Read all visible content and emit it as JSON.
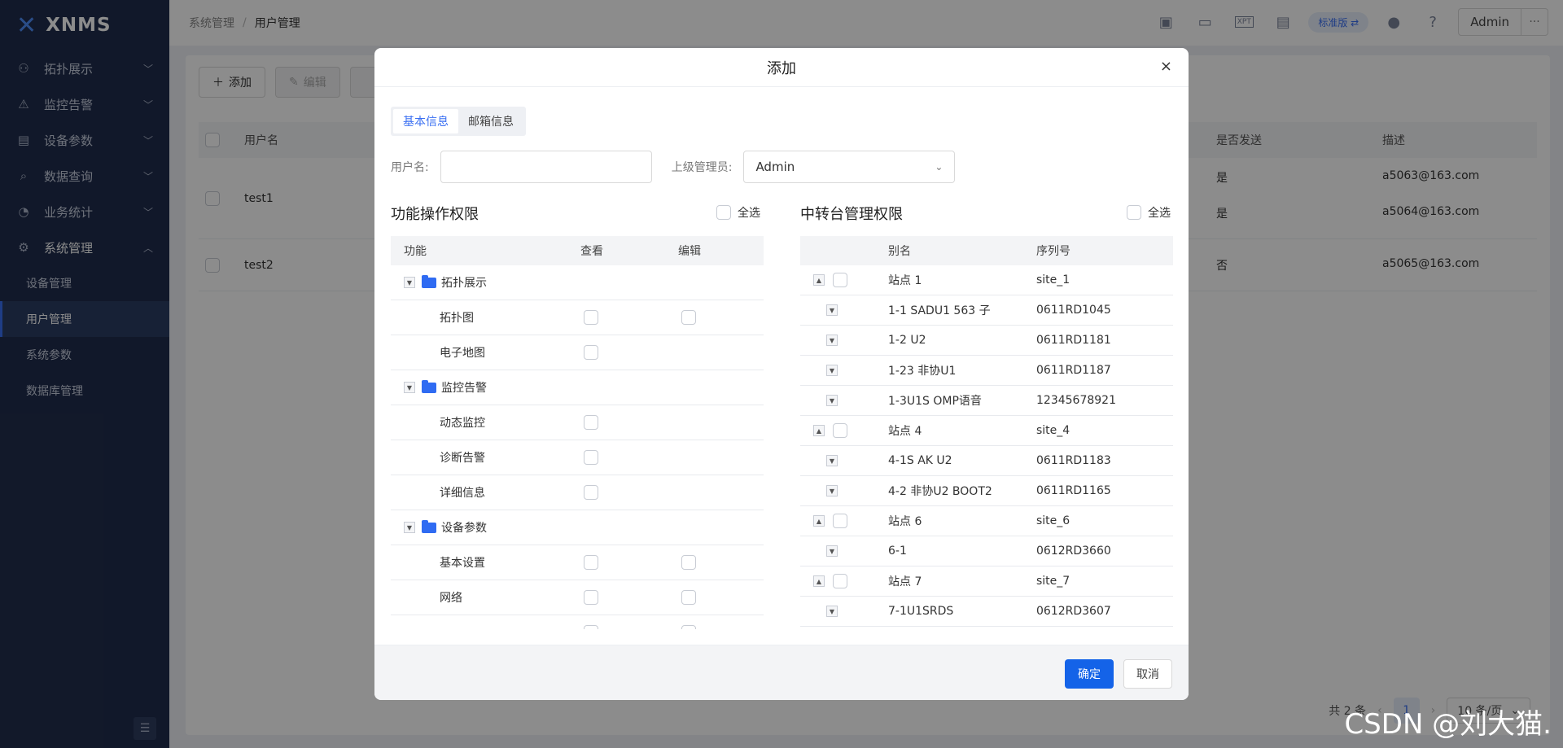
{
  "app": {
    "logo": "XNMS"
  },
  "sidebar": {
    "groups": [
      {
        "label": "拓扑展示",
        "icon": "topology-icon"
      },
      {
        "label": "监控告警",
        "icon": "alarm-icon"
      },
      {
        "label": "设备参数",
        "icon": "clipboard-icon"
      },
      {
        "label": "数据查询",
        "icon": "data-query-icon"
      },
      {
        "label": "业务统计",
        "icon": "pie-chart-icon"
      },
      {
        "label": "系统管理",
        "icon": "gear-icon"
      }
    ],
    "sub_items": [
      "设备管理",
      "用户管理",
      "系统参数",
      "数据库管理"
    ]
  },
  "header": {
    "breadcrumb": [
      "系统管理",
      "用户管理"
    ],
    "edition": "标准版 ⇄",
    "user": "Admin",
    "xpt_label": "XPT"
  },
  "toolbar": {
    "add": "添加",
    "edit": "编辑"
  },
  "bg_table": {
    "col_user": "用户名",
    "col_send": "是否发送",
    "col_desc": "描述",
    "rows": [
      {
        "user": "test1",
        "sends": [
          "是",
          "是"
        ],
        "descs": [
          "a5063@163.com",
          "a5064@163.com"
        ]
      },
      {
        "user": "test2",
        "sends": [
          "否"
        ],
        "descs": [
          "a5065@163.com"
        ]
      }
    ]
  },
  "pager": {
    "total": "共 2 条",
    "page": "1",
    "size": "10 条/页"
  },
  "modal": {
    "title": "添加",
    "close": "×",
    "tabs": [
      "基本信息",
      "邮箱信息"
    ],
    "username_label": "用户名:",
    "username_value": "",
    "manager_label": "上级管理员:",
    "manager_value": "Admin",
    "left_panel": {
      "title": "功能操作权限",
      "select_all": "全选",
      "headers": [
        "功能",
        "查看",
        "编辑"
      ],
      "rows": [
        {
          "name": "拓扑展示",
          "group": true
        },
        {
          "name": "拓扑图",
          "view": true,
          "edit": true
        },
        {
          "name": "电子地图",
          "view": true,
          "edit": false
        },
        {
          "name": "监控告警",
          "group": true
        },
        {
          "name": "动态监控",
          "view": true,
          "edit": false
        },
        {
          "name": "诊断告警",
          "view": true,
          "edit": false
        },
        {
          "name": "详细信息",
          "view": true,
          "edit": false
        },
        {
          "name": "设备参数",
          "group": true
        },
        {
          "name": "基本设置",
          "view": true,
          "edit": true
        },
        {
          "name": "网络",
          "view": true,
          "edit": true
        },
        {
          "name": "",
          "view": true,
          "edit": true
        }
      ]
    },
    "right_panel": {
      "title": "中转台管理权限",
      "select_all": "全选",
      "headers": [
        "别名",
        "序列号"
      ],
      "rows": [
        {
          "alias": "站点 1",
          "serial": "site_1",
          "site": true
        },
        {
          "alias": "1-1 SADU1 563 子",
          "serial": "0611RD1045"
        },
        {
          "alias": "1-2 U2",
          "serial": "0611RD1181"
        },
        {
          "alias": "1-23 非协U1",
          "serial": "0611RD1187"
        },
        {
          "alias": "1-3U1S OMP语音",
          "serial": "12345678921"
        },
        {
          "alias": "站点 4",
          "serial": "site_4",
          "site": true
        },
        {
          "alias": "4-1S AK U2",
          "serial": "0611RD1183"
        },
        {
          "alias": "4-2 非协U2 BOOT2",
          "serial": "0611RD1165"
        },
        {
          "alias": "站点 6",
          "serial": "site_6",
          "site": true
        },
        {
          "alias": "6-1",
          "serial": "0612RD3660"
        },
        {
          "alias": "站点 7",
          "serial": "site_7",
          "site": true
        },
        {
          "alias": "7-1U1SRDS",
          "serial": "0612RD3607"
        }
      ]
    },
    "ok": "确定",
    "cancel": "取消"
  },
  "watermark": "CSDN @刘大猫."
}
